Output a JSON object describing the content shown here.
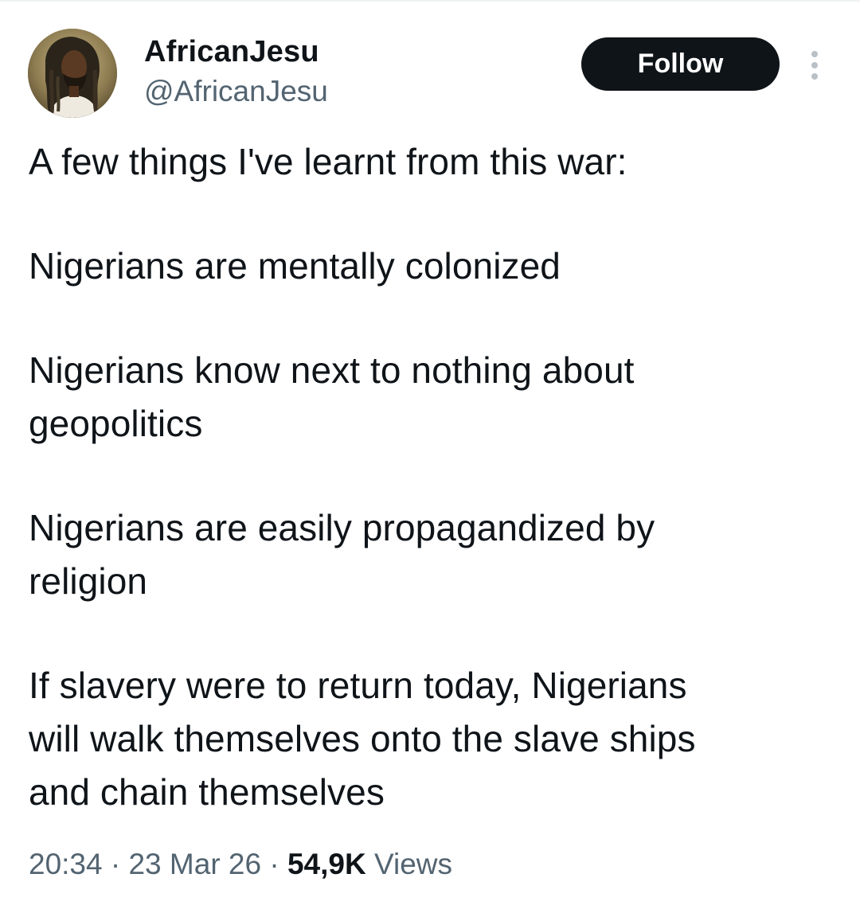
{
  "author": {
    "display_name": "AfricanJesu",
    "handle": "@AfricanJesu"
  },
  "actions": {
    "follow_label": "Follow"
  },
  "icons": {
    "more": "more-vertical-icon",
    "avatar": "profile-photo"
  },
  "tweet": {
    "paragraphs": [
      {
        "lines": [
          "A few things I've learnt from this war:"
        ]
      },
      {
        "lines": [
          "Nigerians are mentally colonized"
        ]
      },
      {
        "lines": [
          "Nigerians know next to nothing about",
          "geopolitics"
        ]
      },
      {
        "lines": [
          "Nigerians are easily propagandized by",
          "religion"
        ]
      },
      {
        "lines": [
          "If slavery were to return today, Nigerians",
          "will walk themselves onto the slave ships",
          "and chain themselves"
        ]
      }
    ]
  },
  "meta": {
    "time": "20:34",
    "separator": "·",
    "date": "23 Mar 26",
    "views_count": "54,9K",
    "views_label": "Views"
  },
  "colors": {
    "text_primary": "#0f1419",
    "text_secondary": "#536471",
    "button_bg": "#0f1419",
    "button_text": "#ffffff"
  }
}
